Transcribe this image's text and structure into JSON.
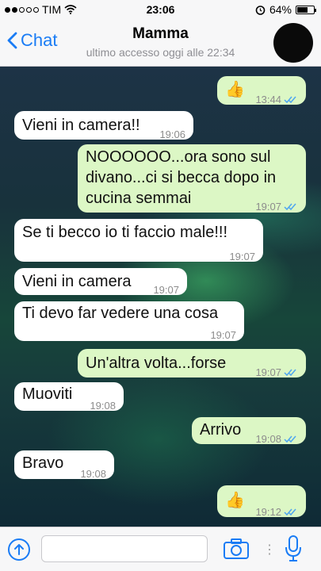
{
  "status_bar": {
    "carrier": "TIM",
    "time": "23:06",
    "battery_percent": "64%",
    "battery_level": 0.64,
    "signal_bars_filled": 2,
    "signal_bars_total": 5,
    "icons": [
      "signal-dots-icon",
      "wifi-icon",
      "alarm-icon",
      "battery-icon"
    ]
  },
  "header": {
    "back_label": "Chat",
    "contact_name": "Mamma",
    "last_seen": "ultimo accesso oggi alle 22:34"
  },
  "messages": [
    {
      "dir": "out",
      "text": "👍",
      "time": "13:44",
      "read": true
    },
    {
      "dir": "in",
      "text": "Vieni in camera!!",
      "time": "19:06"
    },
    {
      "dir": "out",
      "text": "NOOOOOO...ora sono sul divano...ci si becca dopo in cucina semmai",
      "time": "19:07",
      "read": true
    },
    {
      "dir": "in",
      "text": "Se ti becco io ti faccio male!!!",
      "time": "19:07"
    },
    {
      "dir": "in",
      "text": "Vieni in camera",
      "time": "19:07"
    },
    {
      "dir": "in",
      "text": "Ti devo far vedere una cosa",
      "time": "19:07"
    },
    {
      "dir": "out",
      "text": "Un'altra volta...forse",
      "time": "19:07",
      "read": true
    },
    {
      "dir": "in",
      "text": "Muoviti",
      "time": "19:08"
    },
    {
      "dir": "out",
      "text": "Arrivo",
      "time": "19:08",
      "read": true
    },
    {
      "dir": "in",
      "text": "Bravo",
      "time": "19:08"
    },
    {
      "dir": "out",
      "text": "👍",
      "time": "19:12",
      "read": true
    }
  ],
  "input_bar": {
    "placeholder": "",
    "icons": [
      "share-icon",
      "camera-icon",
      "microphone-icon"
    ]
  },
  "colors": {
    "accent": "#1a7cf5",
    "outgoing_bubble": "#dcf7c5",
    "incoming_bubble": "#ffffff",
    "read_ticks": "#4fa6f0"
  }
}
